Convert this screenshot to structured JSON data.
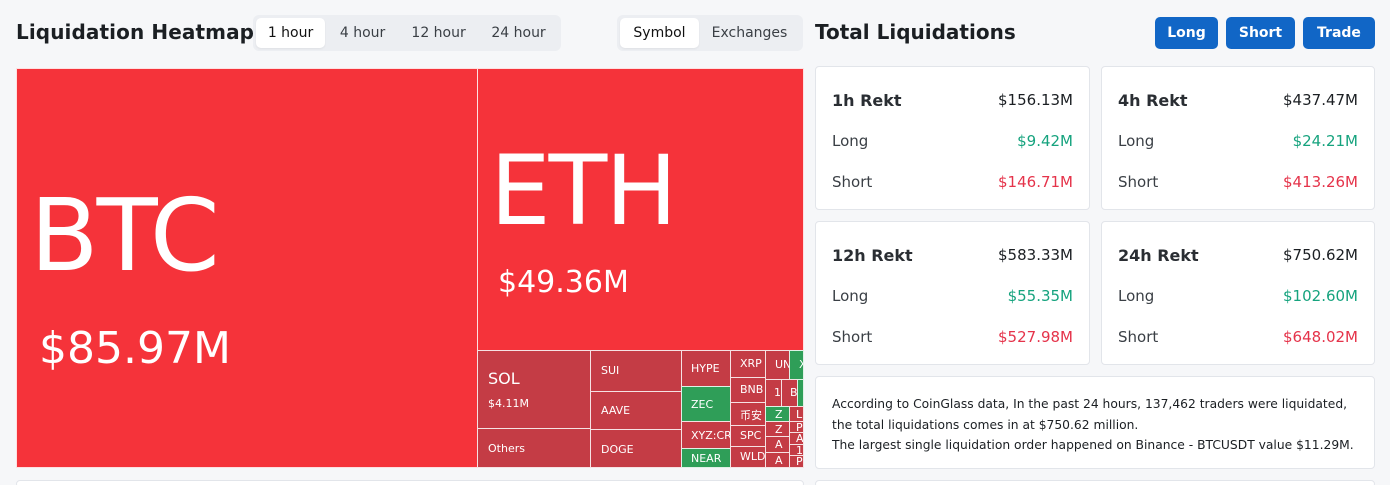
{
  "heatmap": {
    "title": "Liquidation Heatmap",
    "time_options": [
      "1 hour",
      "4 hour",
      "12 hour",
      "24 hour"
    ],
    "time_selected": "1 hour",
    "mode_options": [
      "Symbol",
      "Exchanges"
    ],
    "mode_selected": "Symbol",
    "colors": {
      "long_liq_strong": "#f5333a",
      "long_liq": "#c43c45",
      "short_liq": "#2f9e58"
    },
    "tiles": {
      "btc": {
        "symbol": "BTC",
        "value": "$85.97M"
      },
      "eth": {
        "symbol": "ETH",
        "value": "$49.36M"
      },
      "sol": {
        "symbol": "SOL",
        "value": "$4.11M"
      },
      "others": {
        "symbol": "Others"
      },
      "sui": {
        "symbol": "SUI"
      },
      "aave": {
        "symbol": "AAVE"
      },
      "doge": {
        "symbol": "DOGE"
      },
      "hype": {
        "symbol": "HYPE"
      },
      "zec": {
        "symbol": "ZEC"
      },
      "xyz": {
        "symbol": "XYZ:CR"
      },
      "near": {
        "symbol": "NEAR"
      },
      "xrp": {
        "symbol": "XRP"
      },
      "bnb": {
        "symbol": "BNB"
      },
      "cn": {
        "symbol": "币安"
      },
      "spc": {
        "symbol": "SPC"
      },
      "wld": {
        "symbol": "WLD"
      },
      "un": {
        "symbol": "UN"
      },
      "x": {
        "symbol": "X"
      },
      "one": {
        "symbol": "1"
      },
      "b": {
        "symbol": "B"
      },
      "z1": {
        "symbol": "Z"
      },
      "z2": {
        "symbol": "Z"
      },
      "l": {
        "symbol": "L"
      },
      "p1": {
        "symbol": "P"
      },
      "a1": {
        "symbol": "A"
      },
      "a2": {
        "symbol": "A"
      },
      "a3": {
        "symbol": "A"
      },
      "one2": {
        "symbol": "1"
      },
      "p2": {
        "symbol": "P"
      }
    }
  },
  "totals": {
    "title": "Total Liquidations",
    "buttons": {
      "long": "Long",
      "short": "Short",
      "trade": "Trade"
    },
    "cards": [
      {
        "label": "1h Rekt",
        "total": "$156.13M",
        "long_label": "Long",
        "long": "$9.42M",
        "short_label": "Short",
        "short": "$146.71M"
      },
      {
        "label": "4h Rekt",
        "total": "$437.47M",
        "long_label": "Long",
        "long": "$24.21M",
        "short_label": "Short",
        "short": "$413.26M"
      },
      {
        "label": "12h Rekt",
        "total": "$583.33M",
        "long_label": "Long",
        "long": "$55.35M",
        "short_label": "Short",
        "short": "$527.98M"
      },
      {
        "label": "24h Rekt",
        "total": "$750.62M",
        "long_label": "Long",
        "long": "$102.60M",
        "short_label": "Short",
        "short": "$648.02M"
      }
    ],
    "summary_line1": "According to CoinGlass data, In the past 24 hours, 137,462 traders were liquidated, the total liquidations comes in at $750.62 million.",
    "summary_line2": "The largest single liquidation order happened on Binance - BTCUSDT value $11.29M."
  }
}
